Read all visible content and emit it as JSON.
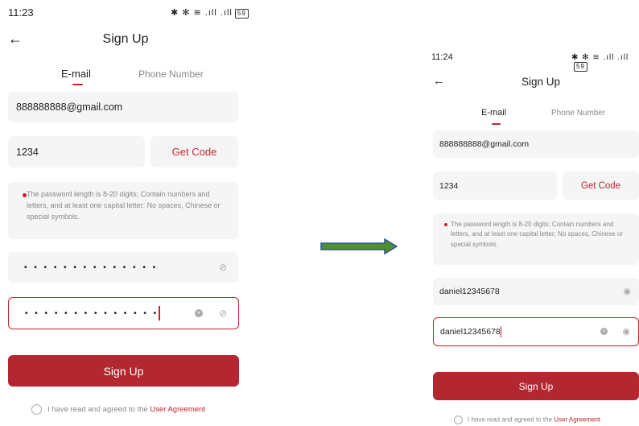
{
  "left": {
    "status": {
      "time": "11:23",
      "icons": "✱ ✻ ≋ .ıll .ıll",
      "battery": "59"
    },
    "header": {
      "title": "Sign Up"
    },
    "tabs": [
      {
        "label": "E-mail"
      },
      {
        "label": "Phone Number"
      }
    ],
    "email": {
      "value": "888888888@gmail.com"
    },
    "code": {
      "value": "1234",
      "button": "Get Code"
    },
    "hint": {
      "text": "The password length is 8-20 digits; Contain numbers and letters, and at least one capital letter; No spaces, Chinese or special symbols."
    },
    "password": {
      "value": "• • • • • • • • • • • • • •"
    },
    "confirm": {
      "value": "• • • • • • • • • • • • • •"
    },
    "button": {
      "label": "Sign Up"
    },
    "agreement": {
      "text": "I have read and agreed to the ",
      "link": "User Agreement"
    }
  },
  "right": {
    "status": {
      "time": "11:24",
      "icons": "✱ ✻ ≋ .ıll .ıll",
      "battery": "59"
    },
    "header": {
      "title": "Sign Up"
    },
    "tabs": [
      {
        "label": "E-mail"
      },
      {
        "label": "Phone Number"
      }
    ],
    "email": {
      "value": "888888888@gmail.com"
    },
    "code": {
      "value": "1234",
      "button": "Get Code"
    },
    "hint": {
      "text": "The password length is 8-20 digits; Contain numbers and letters, and at least one capital letter; No spaces, Chinese or special symbols."
    },
    "password": {
      "value": "daniel12345678"
    },
    "confirm": {
      "value": "daniel12345678"
    },
    "button": {
      "label": "Sign Up"
    },
    "agreement": {
      "text": "I have read and agreed to the ",
      "link": "User Agreement"
    }
  },
  "colors": {
    "accent": "#c0242f",
    "button": "#b22730",
    "field": "#f5f5f5",
    "arrow_fill": "#4f8f2c",
    "arrow_stroke": "#2f5597"
  },
  "arrow": {
    "icon": "right-arrow-icon"
  }
}
